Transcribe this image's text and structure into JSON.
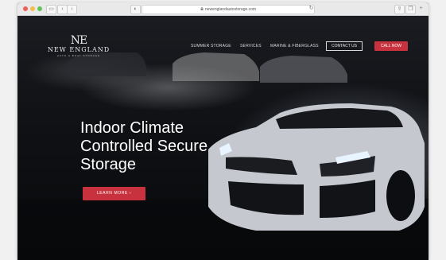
{
  "browser": {
    "url": "newenglandautostorage.com",
    "back": "‹",
    "forward": "›"
  },
  "logo": {
    "mark": "NE",
    "name": "NEW ENGLAND",
    "tagline": "AUTO & BOAT STORAGE"
  },
  "nav": {
    "items": [
      "SUMMER STORAGE",
      "SERVICES",
      "MARINE & FIBERGLASS"
    ],
    "contact_label": "CONTACT US",
    "call_label": "CALL NOW"
  },
  "hero": {
    "headline_line1": "Indoor Climate",
    "headline_line2": "Controlled Secure",
    "headline_line3": "Storage",
    "cta_label": "LEARN MORE ›"
  },
  "colors": {
    "accent": "#c8323f",
    "background": "#0b0c0f"
  }
}
